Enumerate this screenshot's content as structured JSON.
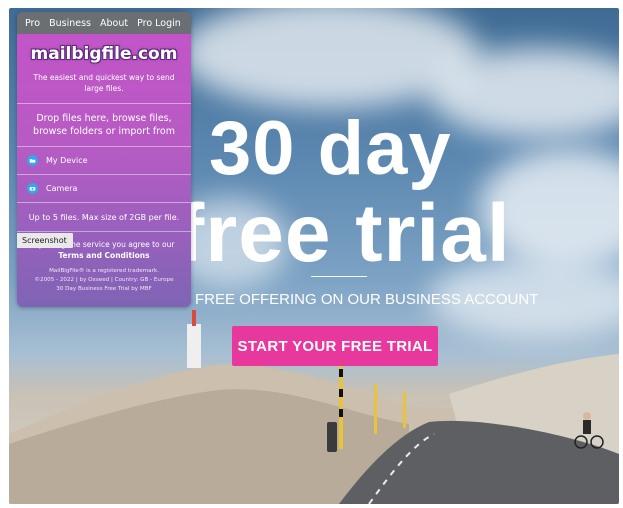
{
  "nav": {
    "items": [
      "Pro",
      "Business",
      "About",
      "Pro Login"
    ]
  },
  "panel": {
    "brand": "mailbigfile.com",
    "tagline": "The easiest and quickest way to send large files.",
    "drop_text": "Drop files here, browse files, browse folders or import from",
    "my_device": "My Device",
    "camera": "Camera",
    "limits": "Up to 5 files. Max size of 2GB per file.",
    "agree_text": "By using the service you agree to our",
    "terms_link": "Terms and Conditions",
    "screenshot_tag": "Screenshot",
    "footer_line1": "MailBigFile® is a registered trademark.",
    "footer_line2": "©2005 - 2022 | by Oxseed | Country: GB - Europe",
    "footer_line3": "30 Day Business Free Trial by MBF"
  },
  "hero": {
    "line1": "30 day",
    "line2": "free trial",
    "subtitle": "FREE OFFERING ON OUR BUSINESS ACCOUNT",
    "cta": "START YOUR FREE TRIAL"
  },
  "colors": {
    "accent": "#e8389e",
    "device_icon": "#35a6e8",
    "nav_bg": "#6b6f73"
  }
}
